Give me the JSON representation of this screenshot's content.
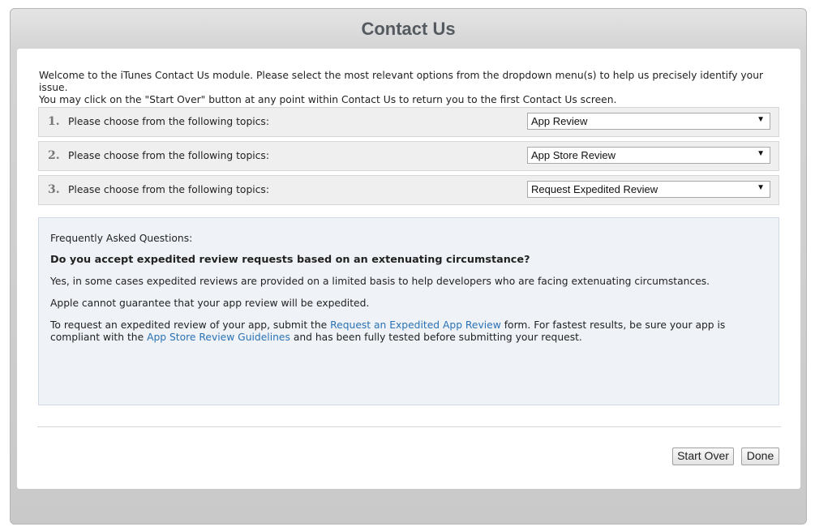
{
  "title": "Contact Us",
  "intro": {
    "line1": "Welcome to the iTunes Contact Us module. Please select the most relevant options from the dropdown menu(s) to help us precisely identify your issue.",
    "line2": "You may click on the \"Start Over\" button at any point within Contact Us to return you to the first Contact Us screen."
  },
  "topics": [
    {
      "number": "1.",
      "label": "Please choose from the following topics:",
      "selected": "App Review"
    },
    {
      "number": "2.",
      "label": "Please choose from the following topics:",
      "selected": "App Store Review"
    },
    {
      "number": "3.",
      "label": "Please choose from the following topics:",
      "selected": "Request Expedited Review"
    }
  ],
  "faq": {
    "heading": "Frequently Asked Questions:",
    "question": "Do you accept expedited review requests based on an extenuating circumstance?",
    "answer1": "Yes, in some cases expedited reviews are provided on a limited basis to help developers who are facing extenuating circumstances.",
    "answer2": "Apple cannot guarantee that your app review will be expedited.",
    "answer3_pre": "To request an expedited review of your app, submit the ",
    "answer3_link1": "Request an Expedited App Review",
    "answer3_mid": " form. For fastest results, be sure your app is compliant with the ",
    "answer3_link2": "App Store Review Guidelines",
    "answer3_post": " and has been fully tested before submitting your request."
  },
  "buttons": {
    "start_over": "Start Over",
    "done": "Done"
  },
  "icons": {
    "dropdown_arrow": "▼"
  },
  "colors": {
    "link": "#2a72b5",
    "title": "#555a60",
    "faq_bg": "#eff2f7"
  }
}
